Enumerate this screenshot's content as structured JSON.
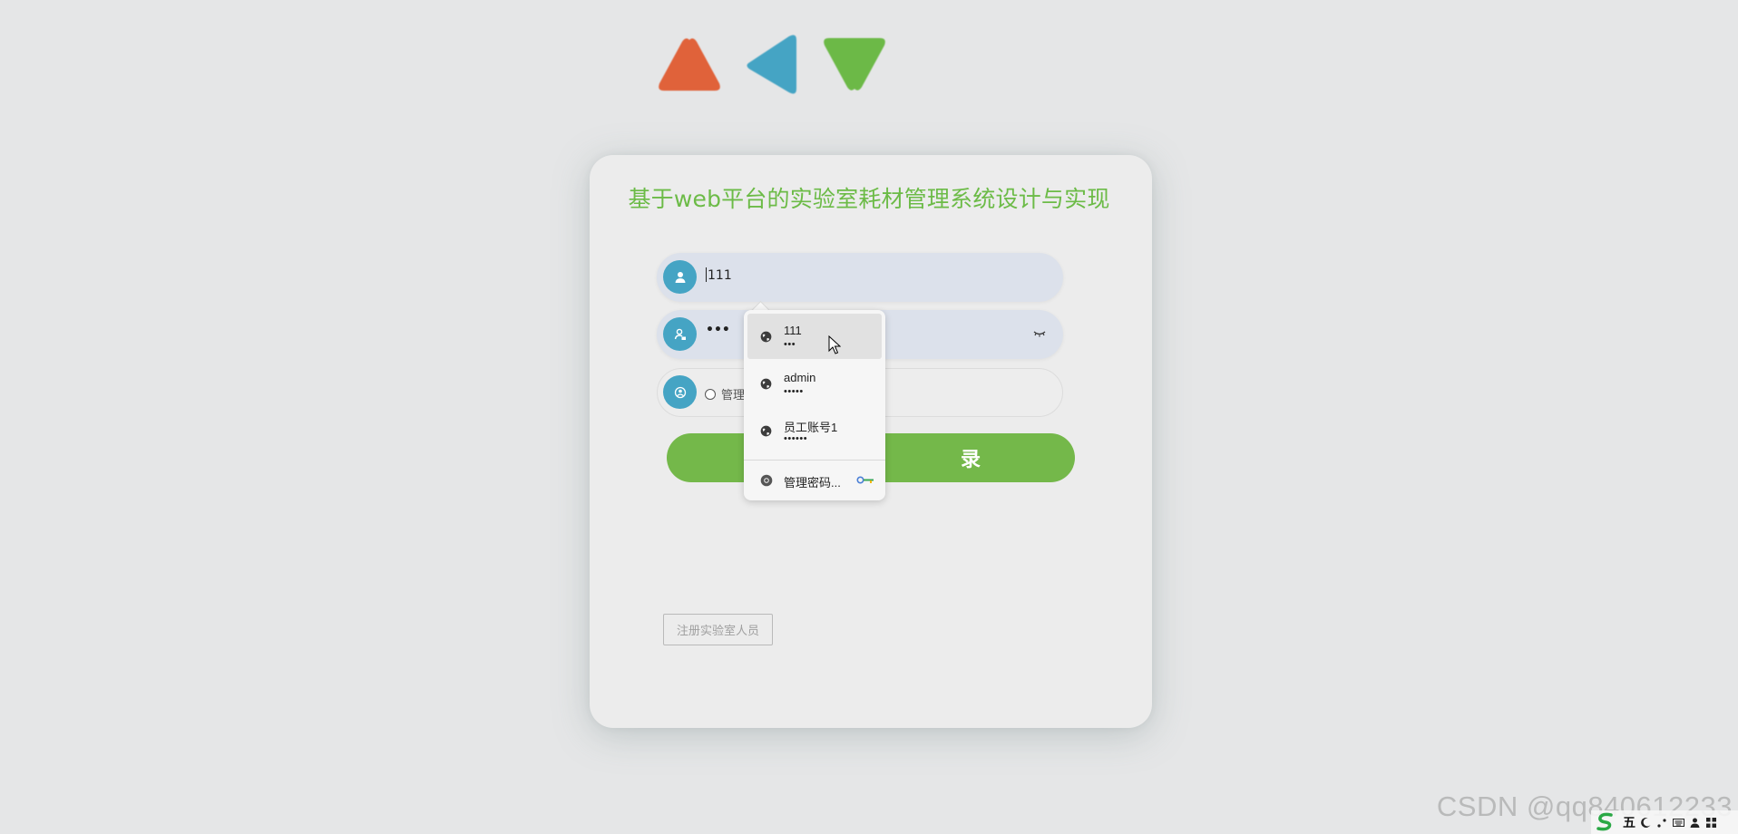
{
  "logo": {
    "shapes": [
      {
        "name": "triangle-up-icon",
        "color": "#e0623a"
      },
      {
        "name": "triangle-left-icon",
        "color": "#45a4c4"
      },
      {
        "name": "triangle-down-icon",
        "color": "#6cb947"
      }
    ]
  },
  "title": "基于web平台的实验室耗材管理系统设计与实现",
  "form": {
    "username_value": "111",
    "password_value": "•••",
    "role_option_label": "管理",
    "login_label": "录",
    "register_label": "注册实验室人员"
  },
  "autofill": {
    "entries": [
      {
        "username": "111",
        "password": "•••"
      },
      {
        "username": "admin",
        "password": "•••••"
      },
      {
        "username": "员工账号1",
        "password": "••••••"
      }
    ],
    "manage_label": "管理密码..."
  },
  "watermark": "CSDN @qq840612233",
  "ime": {
    "mode_label": "五"
  },
  "colors": {
    "accent_green": "#6cbb47",
    "button_green": "#74b84a",
    "icon_blue": "#45a4c4",
    "field_fill": "#dce1eb"
  }
}
